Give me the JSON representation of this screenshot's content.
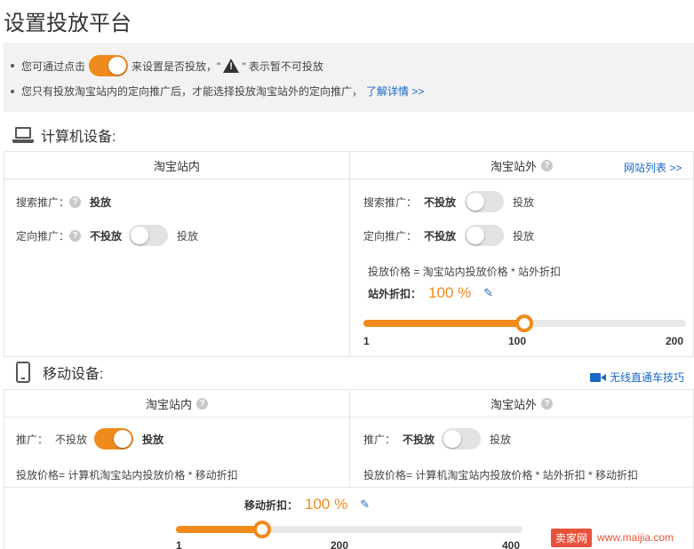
{
  "page": {
    "title": "设置投放平台"
  },
  "notice": {
    "line1_before": "您可通过点击",
    "line1_after": "来设置是否投放，\"",
    "line1_end": "\" 表示暂不可投放",
    "line2_text": "您只有投放淘宝站内的定向推广后，才能选择投放淘宝站外的定向推广，",
    "line2_link": "了解详情 >>"
  },
  "computer": {
    "title": "计算机设备:",
    "inside": {
      "header": "淘宝站内",
      "search_label": "搜索推广：",
      "search_value": "投放",
      "target_label": "定向推广：",
      "target_off": "不投放",
      "target_on": "投放",
      "target_toggle_on": false
    },
    "outside": {
      "header": "淘宝站外",
      "site_list_link": "网站列表 >>",
      "search_label": "搜索推广：",
      "search_off": "不投放",
      "search_on": "投放",
      "search_toggle_on": false,
      "target_label": "定向推广：",
      "target_off": "不投放",
      "target_on": "投放",
      "target_toggle_on": false,
      "formula": "投放价格 = 淘宝站内投放价格 * 站外折扣",
      "discount_label": "站外折扣：",
      "discount_value": "100 %",
      "slider": {
        "min": "1",
        "mid": "100",
        "max": "200",
        "value": 100,
        "range": [
          1,
          200
        ]
      }
    }
  },
  "mobile": {
    "title": "移动设备:",
    "tip_link": "无线直通车技巧",
    "inside": {
      "header": "淘宝站内",
      "promo_label": "推广：",
      "promo_off": "不投放",
      "promo_on": "投放",
      "promo_toggle_on": true,
      "formula": "投放价格= 计算机淘宝站内投放价格 * 移动折扣"
    },
    "outside": {
      "header": "淘宝站外",
      "promo_label": "推广：",
      "promo_off": "不投放",
      "promo_on": "投放",
      "promo_toggle_on": false,
      "formula": "投放价格= 计算机淘宝站内投放价格 * 站外折扣 * 移动折扣"
    },
    "discount_label": "移动折扣：",
    "discount_value": "100 %",
    "slider": {
      "min": "1",
      "mid": "200",
      "max": "400",
      "value": 100,
      "range": [
        1,
        400
      ]
    }
  },
  "watermark": {
    "logo": "卖家网",
    "url": "www.maijia.com"
  },
  "colors": {
    "accent": "#f08a1c",
    "link": "#1a67c9",
    "toggle_off": "#e2e2e2"
  }
}
